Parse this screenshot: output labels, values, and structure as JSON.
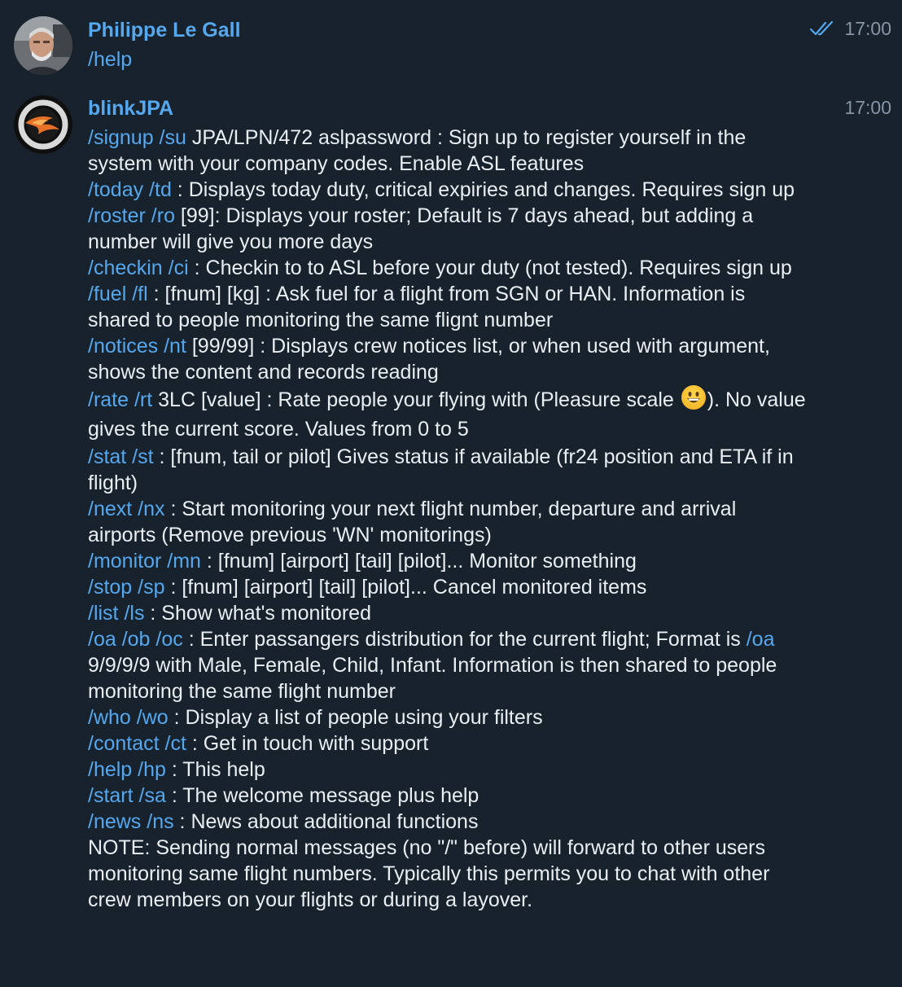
{
  "messages": [
    {
      "sender": "Philippe Le Gall",
      "time": "17:00",
      "read_status_icon": "double-check-icon",
      "text": "/help"
    },
    {
      "sender": "blinkJPA",
      "time": "17:00",
      "lines": [
        {
          "cmd": "/signup /su",
          "text": " JPA/LPN/472 aslpassword : Sign up to register yourself in the system with your company codes. Enable ASL features"
        },
        {
          "cmd": "/today /td",
          "text": " : Displays today duty, critical expiries and changes. Requires sign up"
        },
        {
          "cmd": "/roster /ro",
          "text": " [99]: Displays your roster; Default is 7 days ahead, but adding a number will give you more days"
        },
        {
          "cmd": "/checkin /ci",
          "text": " : Checkin to to ASL before your duty (not tested). Requires sign up"
        },
        {
          "cmd": "/fuel /fl",
          "text": " : [fnum] [kg] : Ask fuel for a flight from SGN or HAN. Information is shared to people monitoring the same flignt number"
        },
        {
          "cmd": "/notices /nt",
          "text": " [99/99] : Displays crew notices list, or when used with argument, shows the content and records reading"
        },
        {
          "cmd": "/rate /rt",
          "text": " 3LC [value] : Rate people your flying with (Pleasure scale ",
          "emoji": "grinning-face-emoji",
          "text_after": "). No value gives the current score. Values from 0 to 5"
        },
        {
          "cmd": "/stat /st",
          "text": " : [fnum, tail or pilot] Gives status if available (fr24 position and ETA if in flight)"
        },
        {
          "cmd": "/next /nx",
          "text": " : Start monitoring your next flight number, departure and arrival airports (Remove previous 'WN' monitorings)"
        },
        {
          "cmd": "/monitor /mn",
          "text": " : [fnum] [airport] [tail] [pilot]... Monitor something"
        },
        {
          "cmd": "/stop /sp",
          "text": " : [fnum] [airport] [tail] [pilot]... Cancel monitored items"
        },
        {
          "cmd": "/list /ls",
          "text": " : Show what's monitored"
        },
        {
          "cmd": "/oa /ob /oc",
          "text": " : Enter passangers distribution for the current flight; Format is ",
          "cmd2": "/oa",
          "text_after": " 9/9/9/9 with Male, Female, Child, Infant. Information is then shared to people monitoring the same flight number"
        },
        {
          "cmd": "/who /wo",
          "text": " : Display a list of people using your filters"
        },
        {
          "cmd": "/contact /ct",
          "text": " : Get in touch with support"
        },
        {
          "cmd": "/help /hp",
          "text": " : This help"
        },
        {
          "cmd": "/start /sa",
          "text": " : The welcome message plus help"
        },
        {
          "cmd": "/news /ns",
          "text": " : News about additional functions"
        },
        {
          "cmd": "",
          "text": "NOTE: Sending normal messages (no \"/\" before) will forward to other users monitoring same flight numbers. Typically this permits you to chat with other crew members on your flights or during a layover."
        }
      ]
    }
  ]
}
